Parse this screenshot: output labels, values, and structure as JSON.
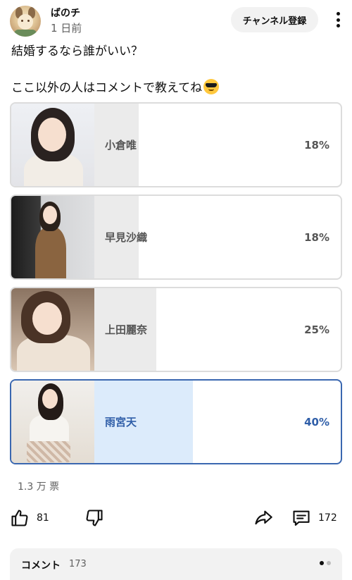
{
  "post": {
    "channel_name": "ばのチ",
    "time": "1 日前",
    "subscribe_label": "チャンネル登録",
    "line1": "結婚するなら誰がいい？",
    "line2": "ここ以外の人はコメントで教えてね"
  },
  "poll": {
    "options": [
      {
        "label": "小倉唯",
        "percent": "18%",
        "fraction": 0.18,
        "selected": false
      },
      {
        "label": "早見沙織",
        "percent": "18%",
        "fraction": 0.18,
        "selected": false
      },
      {
        "label": "上田麗奈",
        "percent": "25%",
        "fraction": 0.25,
        "selected": false
      },
      {
        "label": "雨宮天",
        "percent": "40%",
        "fraction": 0.4,
        "selected": true
      }
    ],
    "votes": "1.3 万 票"
  },
  "actions": {
    "like_count": "81",
    "comment_count": "172"
  },
  "comments": {
    "title": "コメント",
    "count": "173"
  },
  "colors": {
    "selected_border": "#3a67b0",
    "selected_fill": "#dcebfb",
    "result_fill": "#ebebeb",
    "subscribe_bg": "#f2f2f2"
  },
  "icons": [
    "kebab-menu-icon",
    "thumbs-up-icon",
    "thumbs-down-icon",
    "share-icon",
    "comment-icon",
    "sunglasses-emoji-icon"
  ]
}
